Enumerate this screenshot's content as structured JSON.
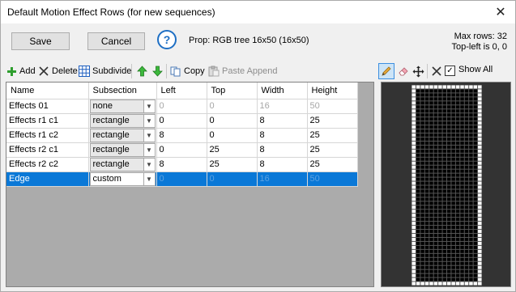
{
  "window": {
    "title": "Default Motion Effect Rows (for new sequences)"
  },
  "buttons": {
    "save": "Save",
    "cancel": "Cancel"
  },
  "help": {
    "glyph": "?"
  },
  "prop_label": "Prop: RGB tree 16x50 (16x50)",
  "info": {
    "max_rows": "Max rows: 32",
    "top_left": "Top-left is 0, 0"
  },
  "toolbar": {
    "add": "Add",
    "delete": "Delete",
    "subdivide": "Subdivide",
    "copy": "Copy",
    "paste_append": "Paste Append"
  },
  "right_toolbar": {
    "show_all_label": "Show All",
    "show_all_checked": true
  },
  "grid": {
    "headers": [
      "Name",
      "Subsection",
      "Left",
      "Top",
      "Width",
      "Height"
    ],
    "rows": [
      {
        "name": "Effects 01",
        "subsection": "none",
        "left": "0",
        "top": "0",
        "width": "16",
        "height": "50",
        "dim": true,
        "selected": false
      },
      {
        "name": "Effects r1 c1",
        "subsection": "rectangle",
        "left": "0",
        "top": "0",
        "width": "8",
        "height": "25",
        "dim": false,
        "selected": false
      },
      {
        "name": "Effects r1 c2",
        "subsection": "rectangle",
        "left": "8",
        "top": "0",
        "width": "8",
        "height": "25",
        "dim": false,
        "selected": false
      },
      {
        "name": "Effects r2 c1",
        "subsection": "rectangle",
        "left": "0",
        "top": "25",
        "width": "8",
        "height": "25",
        "dim": false,
        "selected": false
      },
      {
        "name": "Effects r2 c2",
        "subsection": "rectangle",
        "left": "8",
        "top": "25",
        "width": "8",
        "height": "25",
        "dim": false,
        "selected": false
      },
      {
        "name": "Edge",
        "subsection": "custom",
        "left": "0",
        "top": "0",
        "width": "16",
        "height": "50",
        "dim": true,
        "selected": true
      }
    ]
  },
  "preview": {
    "cols": 16,
    "rows": 50,
    "edge_color": "#ffffff",
    "inner_color": "#000000",
    "line_color": "#555555",
    "background": "#333333"
  },
  "colors": {
    "accent": "#0a78d7",
    "help": "#1e6fc4",
    "add_green": "#2e9e2e"
  }
}
